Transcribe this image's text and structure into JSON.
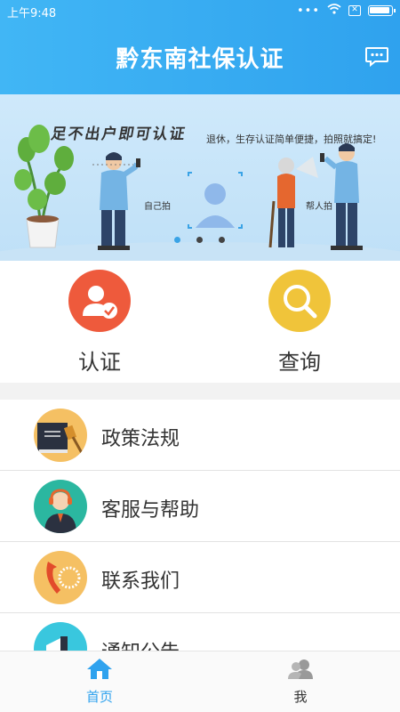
{
  "status": {
    "time": "上午9:48",
    "dots": "•••",
    "sim": "✕"
  },
  "header": {
    "title": "黔东南社保认证",
    "message_icon": "message-icon"
  },
  "banner": {
    "headline": "足不出户即可认证",
    "subline": "退休，生存认证简单便捷，拍照就搞定!",
    "self_label": "自己拍",
    "helper_label": "帮人拍",
    "pages": 3,
    "active_page": 1
  },
  "quick": {
    "certify": {
      "label": "认证",
      "icon": "person-check-icon",
      "color": "#ee5a3c"
    },
    "query": {
      "label": "查询",
      "icon": "search-icon",
      "color": "#f0c43a"
    }
  },
  "menu": [
    {
      "label": "政策法规",
      "icon": "law-book-icon"
    },
    {
      "label": "客服与帮助",
      "icon": "support-agent-icon"
    },
    {
      "label": "联系我们",
      "icon": "phone-icon"
    },
    {
      "label": "通知公告",
      "icon": "megaphone-icon"
    }
  ],
  "tabbar": {
    "home": {
      "label": "首页",
      "icon": "home-icon",
      "active": true
    },
    "me": {
      "label": "我",
      "icon": "users-icon",
      "active": false
    }
  },
  "colors": {
    "primary": "#2fa2ee",
    "inactive": "#333333"
  }
}
